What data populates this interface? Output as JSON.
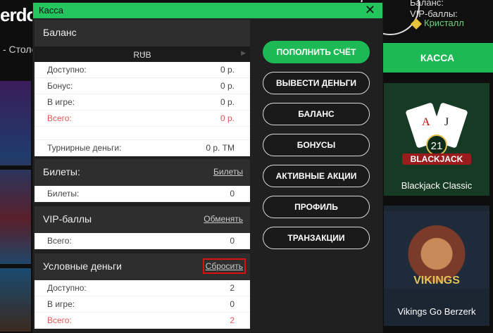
{
  "background": {
    "logo_fragment": "erdo",
    "nav_fragment": "- Столо",
    "right_header": {
      "balance_label": "Баланс:",
      "vip_label": "VIP-баллы:",
      "vip_level": "Кристалл"
    },
    "kassa_tab": "КАССА",
    "game_tiles": [
      {
        "title": "Blackjack Classic",
        "art_text": "BLACKJACK",
        "art_number": "21"
      },
      {
        "title": "Vikings Go Berzerk",
        "art_text": "VIKINGS"
      }
    ]
  },
  "dialog": {
    "title": "Касса",
    "close_glyph": "✕",
    "balance": {
      "header": "Баланс",
      "currency": "RUB",
      "rows": [
        {
          "label": "Доступно:",
          "value": "0 р."
        },
        {
          "label": "Бонус:",
          "value": "0 р."
        },
        {
          "label": "В игре:",
          "value": "0 р."
        },
        {
          "label": "Всего:",
          "value": "0 р."
        }
      ],
      "tournament": {
        "label": "Турнирные деньги:",
        "value": "0 р. ТМ"
      }
    },
    "tickets": {
      "header": "Билеты:",
      "link": "Билеты",
      "rows": [
        {
          "label": "Билеты:",
          "value": "0"
        }
      ]
    },
    "vip": {
      "header": "VIP-баллы",
      "link": "Обменять",
      "rows": [
        {
          "label": "Всего:",
          "value": "0"
        }
      ]
    },
    "play_money": {
      "header": "Условные деньги",
      "link": "Сбросить",
      "rows": [
        {
          "label": "Доступно:",
          "value": "2"
        },
        {
          "label": "В игре:",
          "value": "0"
        },
        {
          "label": "Всего:",
          "value": "2"
        }
      ]
    },
    "buttons": {
      "deposit": "ПОПОЛНИТЬ СЧЁТ",
      "withdraw": "ВЫВЕСТИ ДЕНЬГИ",
      "balance": "БАЛАНС",
      "bonuses": "БОНУСЫ",
      "promotions": "АКТИВНЫЕ АКЦИИ",
      "profile": "ПРОФИЛЬ",
      "transactions": "ТРАНЗАКЦИИ"
    }
  },
  "colors": {
    "accent": "#22c55e",
    "button_green": "#1db954",
    "total_red": "#e05555",
    "highlight_box": "#dd1111"
  }
}
